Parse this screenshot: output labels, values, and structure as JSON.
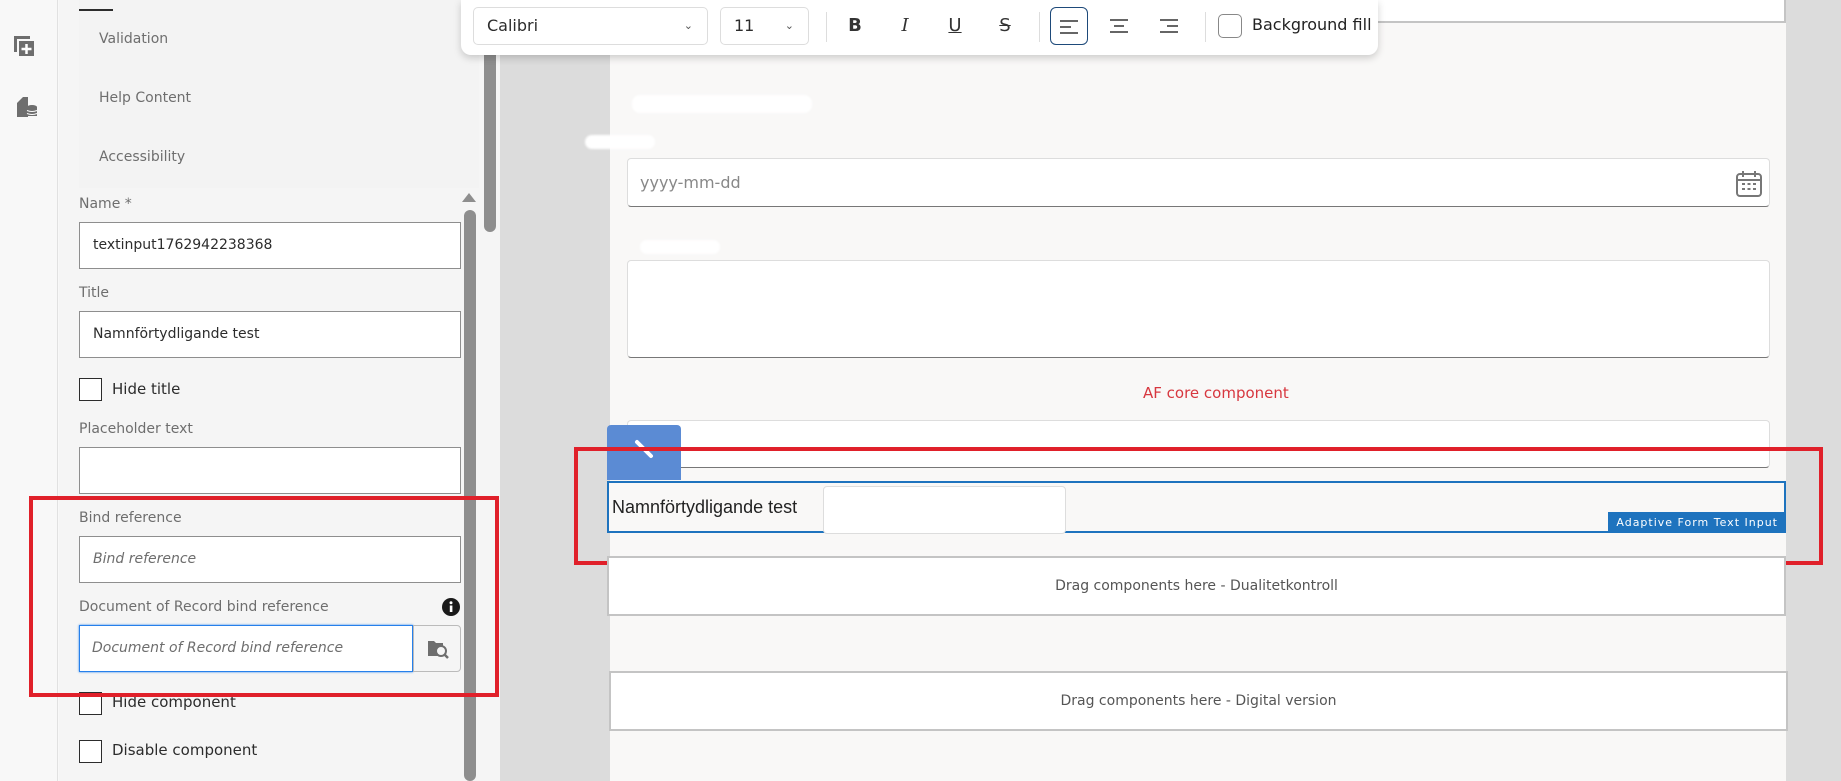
{
  "sidebar_icons": [
    "add-page-icon",
    "data-source-icon"
  ],
  "properties": {
    "tabs": [
      "Validation",
      "Help Content",
      "Accessibility"
    ],
    "name_label": "Name *",
    "name_value": "textinput1762942238368",
    "title_label": "Title",
    "title_value": "Namnförtydligande test",
    "hide_title": "Hide title",
    "placeholder_label": "Placeholder text",
    "placeholder_value": "",
    "bind_label": "Bind reference",
    "bind_placeholder": "Bind reference",
    "dor_label": "Document of Record bind reference",
    "dor_placeholder": "Document of Record bind reference",
    "hide_component": "Hide component",
    "disable_component": "Disable component"
  },
  "toolbar": {
    "font": "Calibri",
    "size": "11",
    "bold": "B",
    "italic": "I",
    "underline": "U",
    "strike": "S",
    "background_fill": "Background fill"
  },
  "canvas": {
    "date_placeholder": "yyyy-mm-dd",
    "af_core_label": "AF core component",
    "selected_label": "Namnförtydligande test",
    "component_badge": "Adaptive Form Text Input",
    "drag_1": "Drag components here - Dualitetkontroll",
    "drag_2": "Drag components here - Digital version"
  },
  "colors": {
    "highlight": "#e0202a",
    "selection": "#1e73be",
    "error_text": "#d7373f"
  }
}
